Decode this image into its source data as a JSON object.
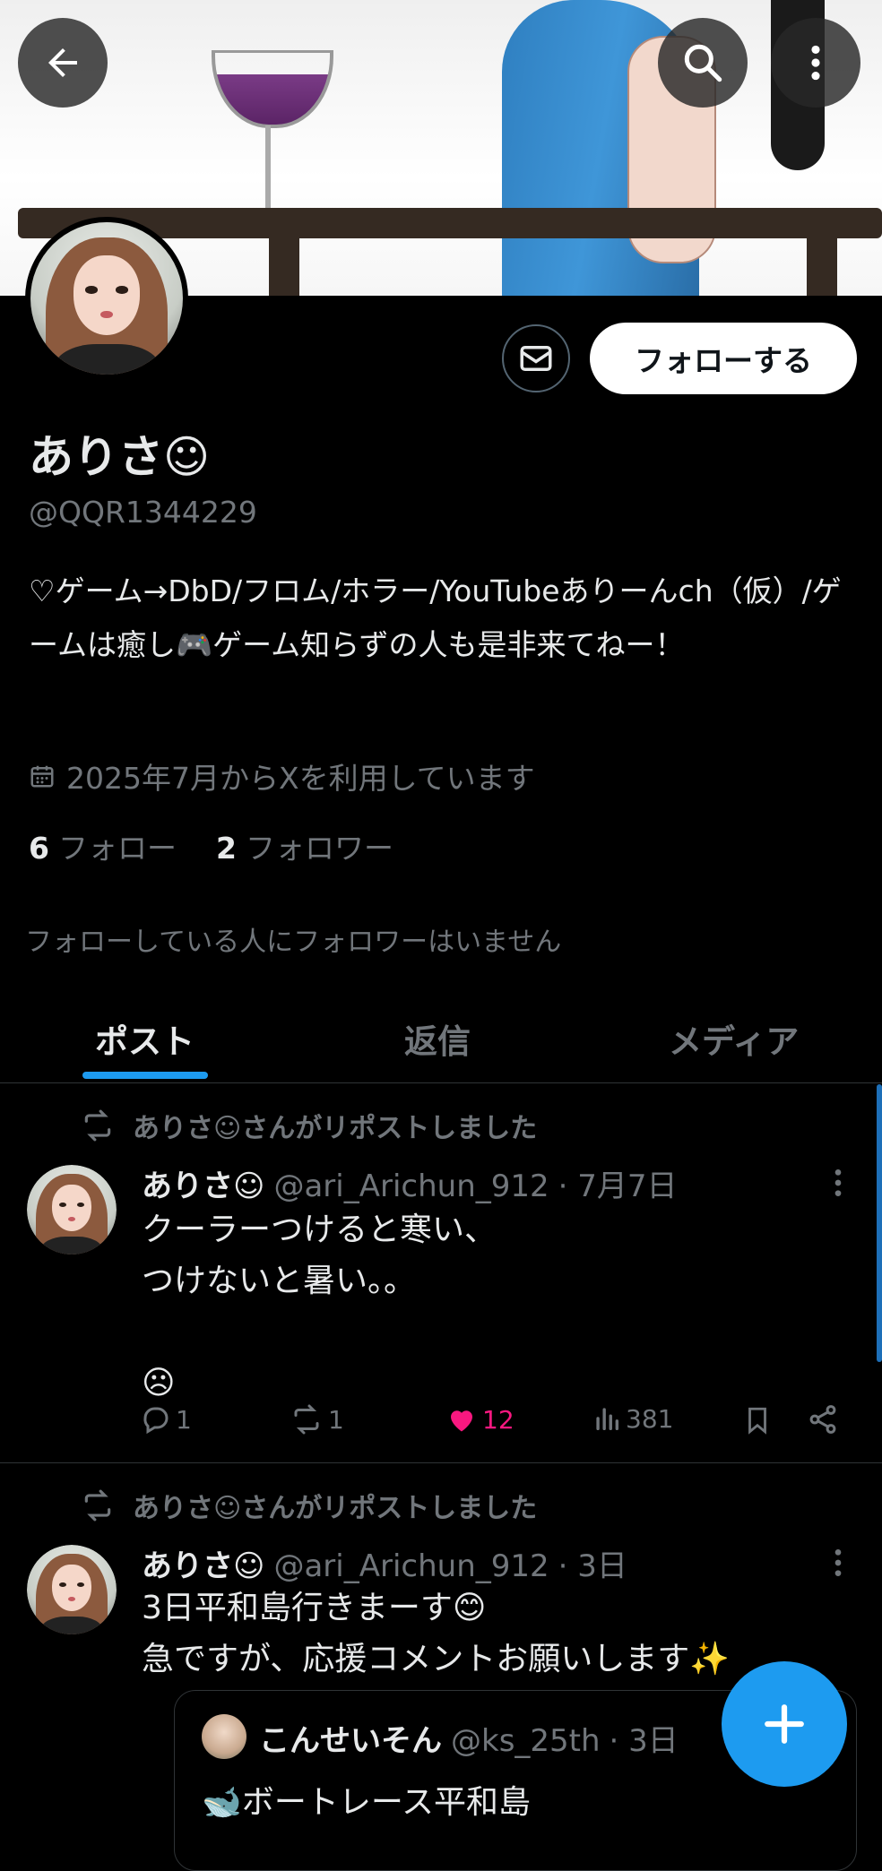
{
  "profile": {
    "name": "ありさ☺",
    "handle": "@QQR1344229",
    "bio": "♡ゲーム→DbD/フロム/ホラー/YouTubeありーんch（仮）/ゲームは癒し🎮ゲーム知らずの人も是非来てねー！",
    "joined": "2025年7月からXを利用しています",
    "following_count": "6",
    "following_label": "フォロー",
    "followers_count": "2",
    "followers_label": "フォロワー",
    "mutual_note": "フォローしている人にフォロワーはいません",
    "follow_button": "フォローする"
  },
  "icons": {
    "back": "arrow-left-icon",
    "search": "search-icon",
    "more": "more-vertical-icon",
    "message": "envelope-icon",
    "calendar": "calendar-icon",
    "compose": "plus-icon"
  },
  "tabs": [
    {
      "label": "ポスト",
      "active": true
    },
    {
      "label": "返信",
      "active": false
    },
    {
      "label": "メディア",
      "active": false
    }
  ],
  "posts": [
    {
      "repost_note": "ありさ☺さんがリポストしました",
      "author_name": "ありさ☺",
      "author_handle": "@ari_Arichun_912",
      "date": "· 7月7日",
      "text": "クーラーつけると寒い、\nつけないと暑い。。\n\n☹",
      "replies": "1",
      "reposts": "1",
      "likes": "12",
      "views": "381"
    },
    {
      "repost_note": "ありさ☺さんがリポストしました",
      "author_name": "ありさ☺",
      "author_handle": "@ari_Arichun_912",
      "date": "· 3日",
      "text": "3日平和島行きまーす😊\n急ですが、応援コメントお願いします✨",
      "quote": {
        "author_name": "こんせいそん",
        "author_handle": "@ks_25th",
        "date": "· 3日",
        "text": "🐋ボートレース平和島"
      }
    }
  ],
  "colors": {
    "accent": "#1d9bf0",
    "like": "#f91880",
    "background": "#000000",
    "muted": "#71767b"
  }
}
